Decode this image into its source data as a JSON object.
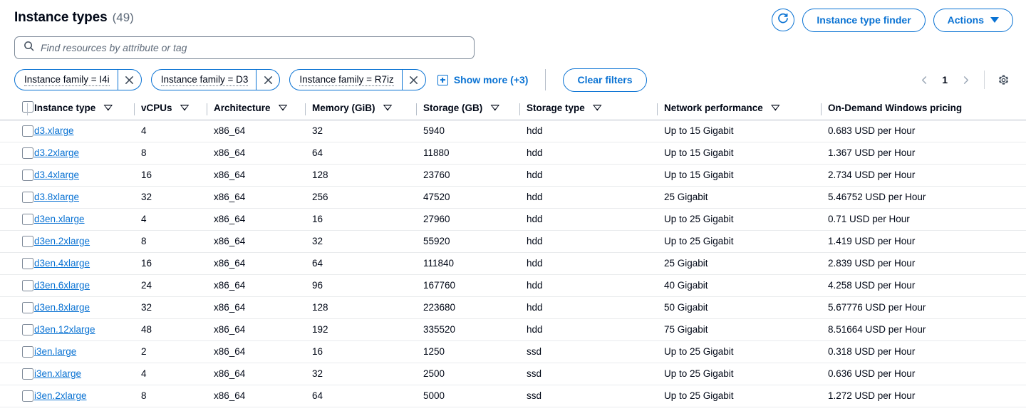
{
  "header": {
    "title": "Instance types",
    "count": "(49)",
    "refresh_icon": "refresh-icon",
    "instance_type_finder_label": "Instance type finder",
    "actions_label": "Actions"
  },
  "search": {
    "placeholder": "Find resources by attribute or tag",
    "value": "",
    "icon": "search-icon"
  },
  "filters": {
    "chips": [
      {
        "label": "Instance family = I4i",
        "dismiss_icon": "close-icon"
      },
      {
        "label": "Instance family = D3",
        "dismiss_icon": "close-icon"
      },
      {
        "label": "Instance family = R7iz",
        "dismiss_icon": "close-icon"
      }
    ],
    "show_more_label": "Show more (+3)",
    "show_more_icon": "plus-box-icon",
    "clear_filters_label": "Clear filters"
  },
  "pagination": {
    "prev_icon": "chevron-left-icon",
    "page": "1",
    "next_icon": "chevron-right-icon",
    "settings_icon": "gear-icon"
  },
  "table": {
    "columns": [
      {
        "label": "Instance type",
        "sortable": true
      },
      {
        "label": "vCPUs",
        "sortable": true
      },
      {
        "label": "Architecture",
        "sortable": true
      },
      {
        "label": "Memory (GiB)",
        "sortable": true
      },
      {
        "label": "Storage (GB)",
        "sortable": true
      },
      {
        "label": "Storage type",
        "sortable": true
      },
      {
        "label": "Network performance",
        "sortable": true
      },
      {
        "label": "On-Demand Windows pricing",
        "sortable": false
      }
    ],
    "rows": [
      {
        "type": "d3.xlarge",
        "vcpus": "4",
        "arch": "x86_64",
        "memory": "32",
        "storage": "5940",
        "storage_type": "hdd",
        "network": "Up to 15 Gigabit",
        "price": "0.683 USD per Hour"
      },
      {
        "type": "d3.2xlarge",
        "vcpus": "8",
        "arch": "x86_64",
        "memory": "64",
        "storage": "11880",
        "storage_type": "hdd",
        "network": "Up to 15 Gigabit",
        "price": "1.367 USD per Hour"
      },
      {
        "type": "d3.4xlarge",
        "vcpus": "16",
        "arch": "x86_64",
        "memory": "128",
        "storage": "23760",
        "storage_type": "hdd",
        "network": "Up to 15 Gigabit",
        "price": "2.734 USD per Hour"
      },
      {
        "type": "d3.8xlarge",
        "vcpus": "32",
        "arch": "x86_64",
        "memory": "256",
        "storage": "47520",
        "storage_type": "hdd",
        "network": "25 Gigabit",
        "price": "5.46752 USD per Hour"
      },
      {
        "type": "d3en.xlarge",
        "vcpus": "4",
        "arch": "x86_64",
        "memory": "16",
        "storage": "27960",
        "storage_type": "hdd",
        "network": "Up to 25 Gigabit",
        "price": "0.71 USD per Hour"
      },
      {
        "type": "d3en.2xlarge",
        "vcpus": "8",
        "arch": "x86_64",
        "memory": "32",
        "storage": "55920",
        "storage_type": "hdd",
        "network": "Up to 25 Gigabit",
        "price": "1.419 USD per Hour"
      },
      {
        "type": "d3en.4xlarge",
        "vcpus": "16",
        "arch": "x86_64",
        "memory": "64",
        "storage": "111840",
        "storage_type": "hdd",
        "network": "25 Gigabit",
        "price": "2.839 USD per Hour"
      },
      {
        "type": "d3en.6xlarge",
        "vcpus": "24",
        "arch": "x86_64",
        "memory": "96",
        "storage": "167760",
        "storage_type": "hdd",
        "network": "40 Gigabit",
        "price": "4.258 USD per Hour"
      },
      {
        "type": "d3en.8xlarge",
        "vcpus": "32",
        "arch": "x86_64",
        "memory": "128",
        "storage": "223680",
        "storage_type": "hdd",
        "network": "50 Gigabit",
        "price": "5.67776 USD per Hour"
      },
      {
        "type": "d3en.12xlarge",
        "vcpus": "48",
        "arch": "x86_64",
        "memory": "192",
        "storage": "335520",
        "storage_type": "hdd",
        "network": "75 Gigabit",
        "price": "8.51664 USD per Hour"
      },
      {
        "type": "i3en.large",
        "vcpus": "2",
        "arch": "x86_64",
        "memory": "16",
        "storage": "1250",
        "storage_type": "ssd",
        "network": "Up to 25 Gigabit",
        "price": "0.318 USD per Hour"
      },
      {
        "type": "i3en.xlarge",
        "vcpus": "4",
        "arch": "x86_64",
        "memory": "32",
        "storage": "2500",
        "storage_type": "ssd",
        "network": "Up to 25 Gigabit",
        "price": "0.636 USD per Hour"
      },
      {
        "type": "i3en.2xlarge",
        "vcpus": "8",
        "arch": "x86_64",
        "memory": "64",
        "storage": "5000",
        "storage_type": "ssd",
        "network": "Up to 25 Gigabit",
        "price": "1.272 USD per Hour"
      }
    ]
  },
  "colors": {
    "link": "#0972d3",
    "text": "#000716",
    "muted": "#5f6b7a",
    "border": "#b6bec9",
    "row_divider": "#e9ebed"
  }
}
